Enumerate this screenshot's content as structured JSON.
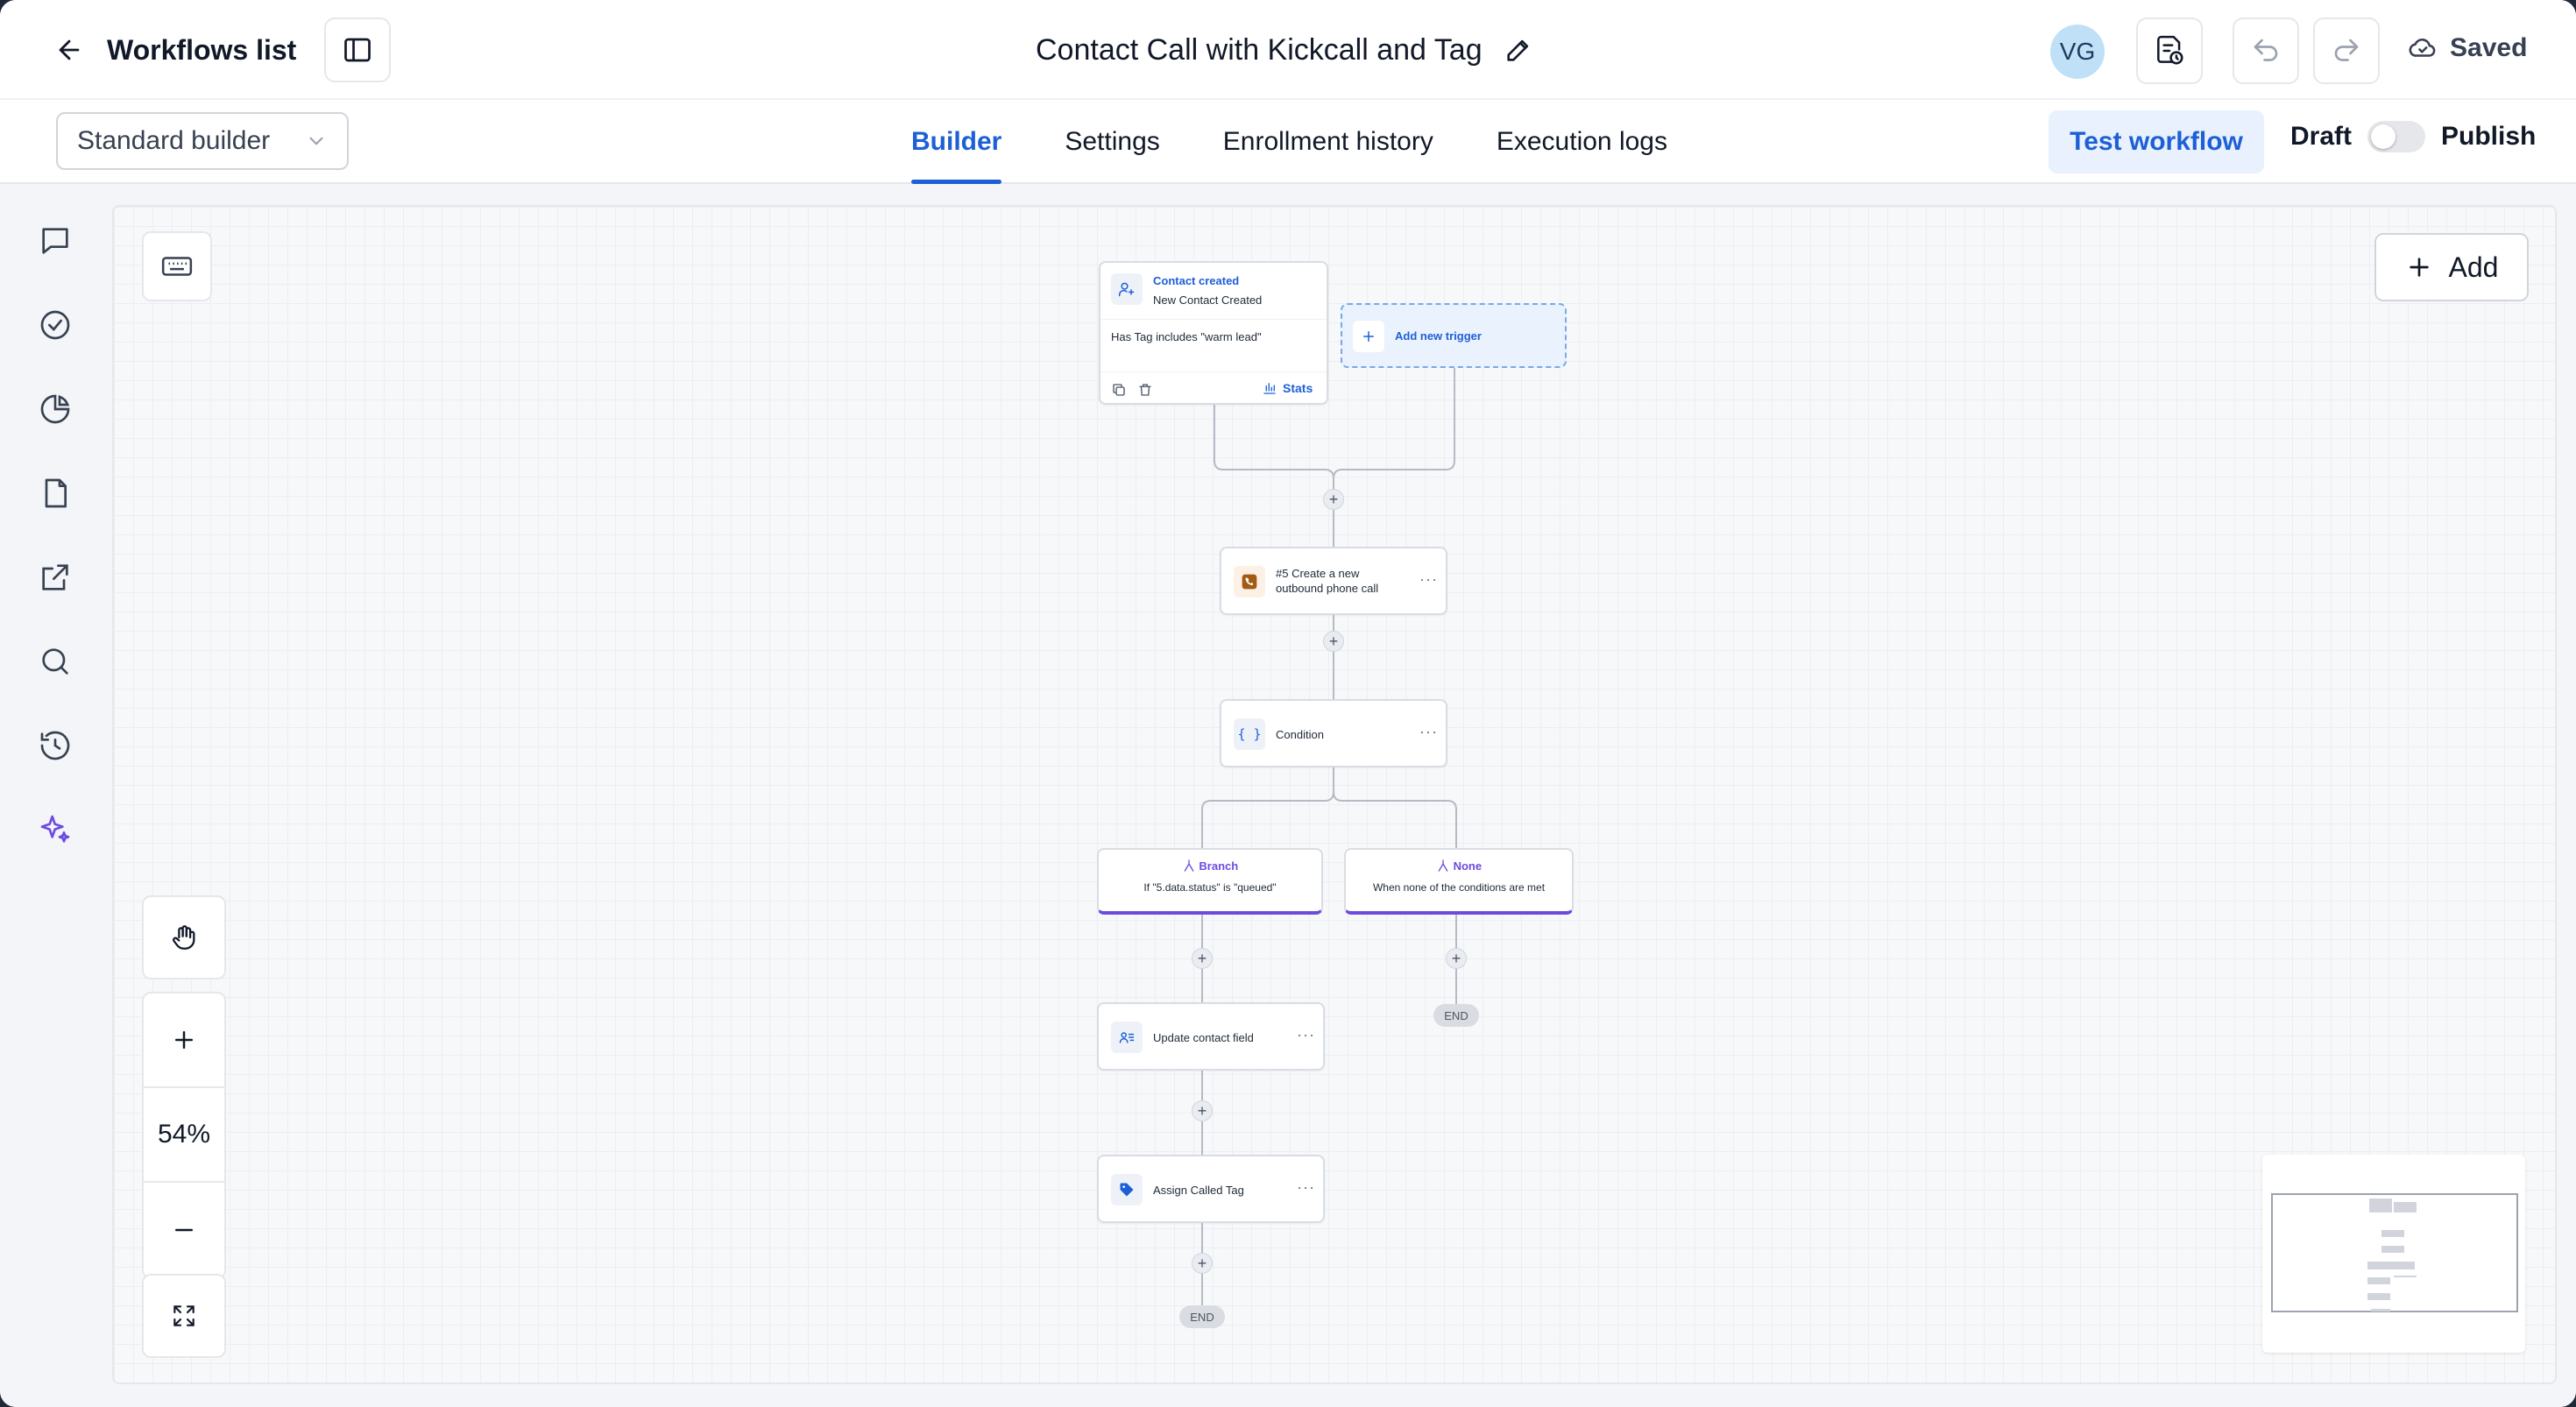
{
  "header": {
    "back_label": "Workflows list",
    "workflow_title": "Contact Call with Kickcall and Tag",
    "avatar_initials": "VG",
    "saved_label": "Saved"
  },
  "subbar": {
    "builder_select": "Standard builder",
    "tabs": [
      {
        "label": "Builder",
        "active": true
      },
      {
        "label": "Settings",
        "active": false
      },
      {
        "label": "Enrollment history",
        "active": false
      },
      {
        "label": "Execution logs",
        "active": false
      }
    ],
    "test_workflow": "Test workflow",
    "draft_label": "Draft",
    "publish_label": "Publish"
  },
  "canvas": {
    "add_label": "Add",
    "zoom_level": "54%",
    "trigger": {
      "title": "Contact created",
      "subtitle": "New Contact Created",
      "filter": "Has Tag includes \"warm lead\"",
      "stats_label": "Stats"
    },
    "add_trigger_label": "Add new trigger",
    "action_call": "#5 Create a new outbound phone call",
    "condition": "Condition",
    "branch_a": {
      "title": "Branch",
      "subtitle": "If \"5.data.status\" is \"queued\""
    },
    "branch_none": {
      "title": "None",
      "subtitle": "When none of the conditions are met"
    },
    "update_field": "Update contact field",
    "assign_tag": "Assign Called Tag",
    "end_label": "END"
  },
  "colors": {
    "accent": "#1d5fd6",
    "branch": "#6d4be0",
    "call_icon": "#a35b14"
  }
}
